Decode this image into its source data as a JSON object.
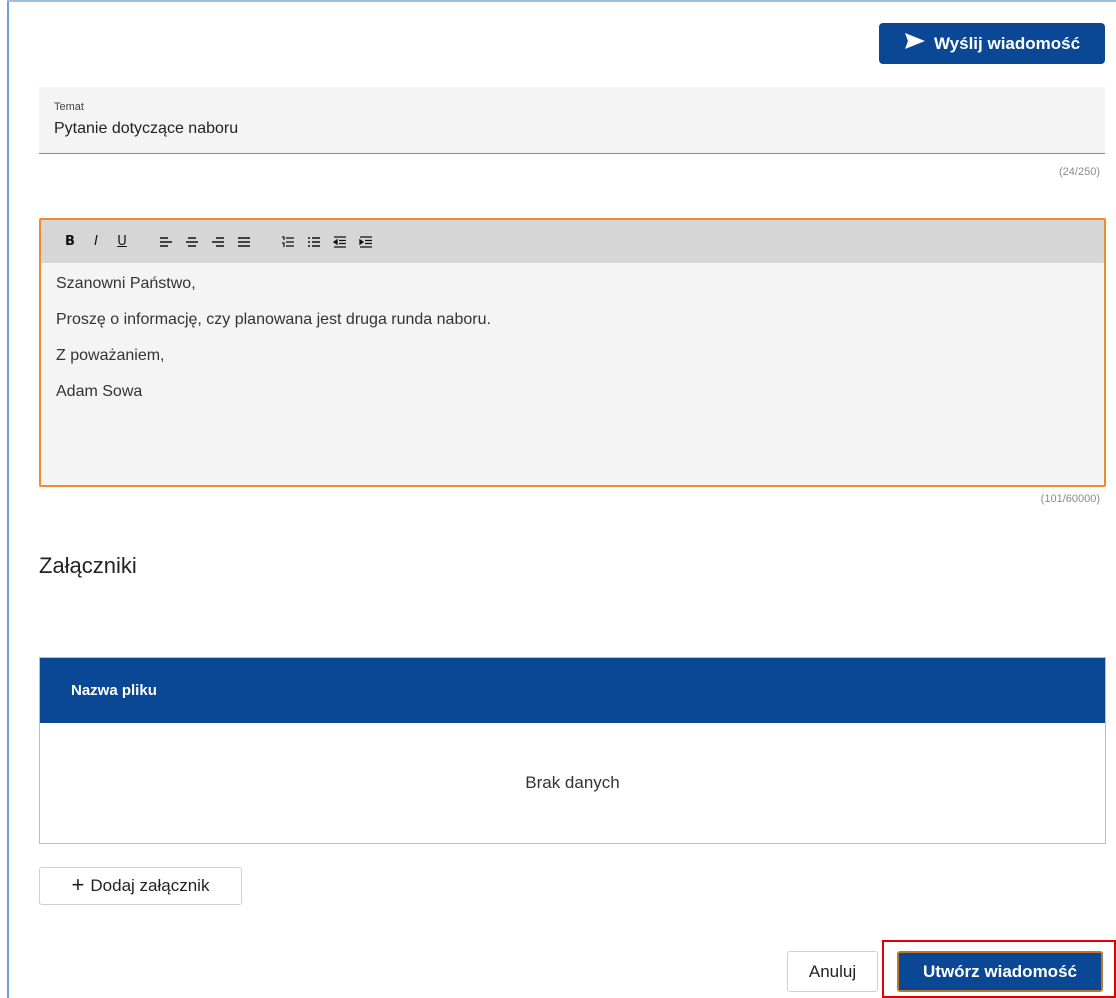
{
  "header": {
    "send_label": "Wyślij wiadomość",
    "send_icon": "send-icon"
  },
  "subject": {
    "label": "Temat",
    "value": "Pytanie dotyczące naboru",
    "counter": "(24/250)"
  },
  "editor": {
    "toolbar": [
      {
        "name": "bold",
        "glyph": "B"
      },
      {
        "name": "italic",
        "glyph": "I"
      },
      {
        "name": "underline",
        "glyph": "U"
      },
      {
        "name": "align-left"
      },
      {
        "name": "align-center"
      },
      {
        "name": "align-right"
      },
      {
        "name": "align-justify"
      },
      {
        "name": "ordered-list"
      },
      {
        "name": "unordered-list"
      },
      {
        "name": "outdent"
      },
      {
        "name": "indent"
      }
    ],
    "lines": [
      "Szanowni Państwo,",
      "Proszę o informację, czy planowana jest druga runda naboru.",
      "Z poważaniem,",
      "Adam Sowa"
    ],
    "counter": "(101/60000)"
  },
  "attachments": {
    "title": "Załączniki",
    "column_header": "Nazwa pliku",
    "empty_text": "Brak danych",
    "add_label": "Dodaj załącznik"
  },
  "footer": {
    "cancel_label": "Anuluj",
    "create_label": "Utwórz wiadomość"
  },
  "colors": {
    "primary": "#0a4896",
    "focus": "#f08a2c",
    "highlight": "#e00000"
  }
}
